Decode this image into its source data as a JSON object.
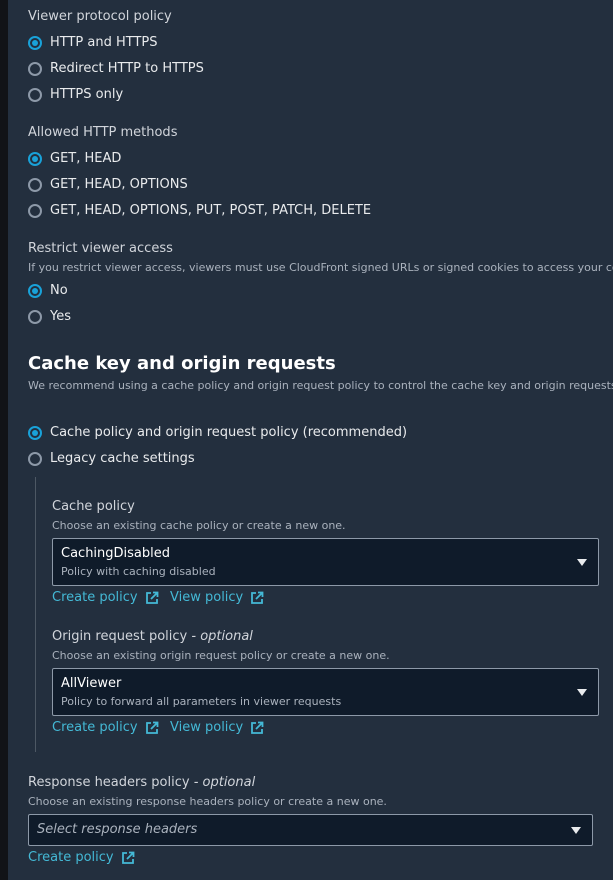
{
  "viewer_protocol": {
    "label": "Viewer protocol policy",
    "options": [
      "HTTP and HTTPS",
      "Redirect HTTP to HTTPS",
      "HTTPS only"
    ],
    "selected": 0
  },
  "allowed_methods": {
    "label": "Allowed HTTP methods",
    "options": [
      "GET, HEAD",
      "GET, HEAD, OPTIONS",
      "GET, HEAD, OPTIONS, PUT, POST, PATCH, DELETE"
    ],
    "selected": 0
  },
  "restrict_access": {
    "label": "Restrict viewer access",
    "help": "If you restrict viewer access, viewers must use CloudFront signed URLs or signed cookies to access your content.",
    "options": [
      "No",
      "Yes"
    ],
    "selected": 0
  },
  "cache_section": {
    "title": "Cache key and origin requests",
    "description": "We recommend using a cache policy and origin request policy to control the cache key and origin requests.",
    "options": [
      "Cache policy and origin request policy (recommended)",
      "Legacy cache settings"
    ],
    "selected": 0
  },
  "cache_policy": {
    "label": "Cache policy",
    "help": "Choose an existing cache policy or create a new one.",
    "value": "CachingDisabled",
    "value_description": "Policy with caching disabled",
    "create_link": "Create policy",
    "view_link": "View policy"
  },
  "origin_request_policy": {
    "label": "Origin request policy",
    "optional": "- optional",
    "help": "Choose an existing origin request policy or create a new one.",
    "value": "AllViewer",
    "value_description": "Policy to forward all parameters in viewer requests",
    "create_link": "Create policy",
    "view_link": "View policy"
  },
  "response_headers_policy": {
    "label": "Response headers policy",
    "optional": "- optional",
    "help": "Choose an existing response headers policy or create a new one.",
    "placeholder": "Select response headers",
    "create_link": "Create policy"
  },
  "colors": {
    "background": "#232f3e",
    "accent": "#19a2d9",
    "link": "#44b9d6"
  }
}
